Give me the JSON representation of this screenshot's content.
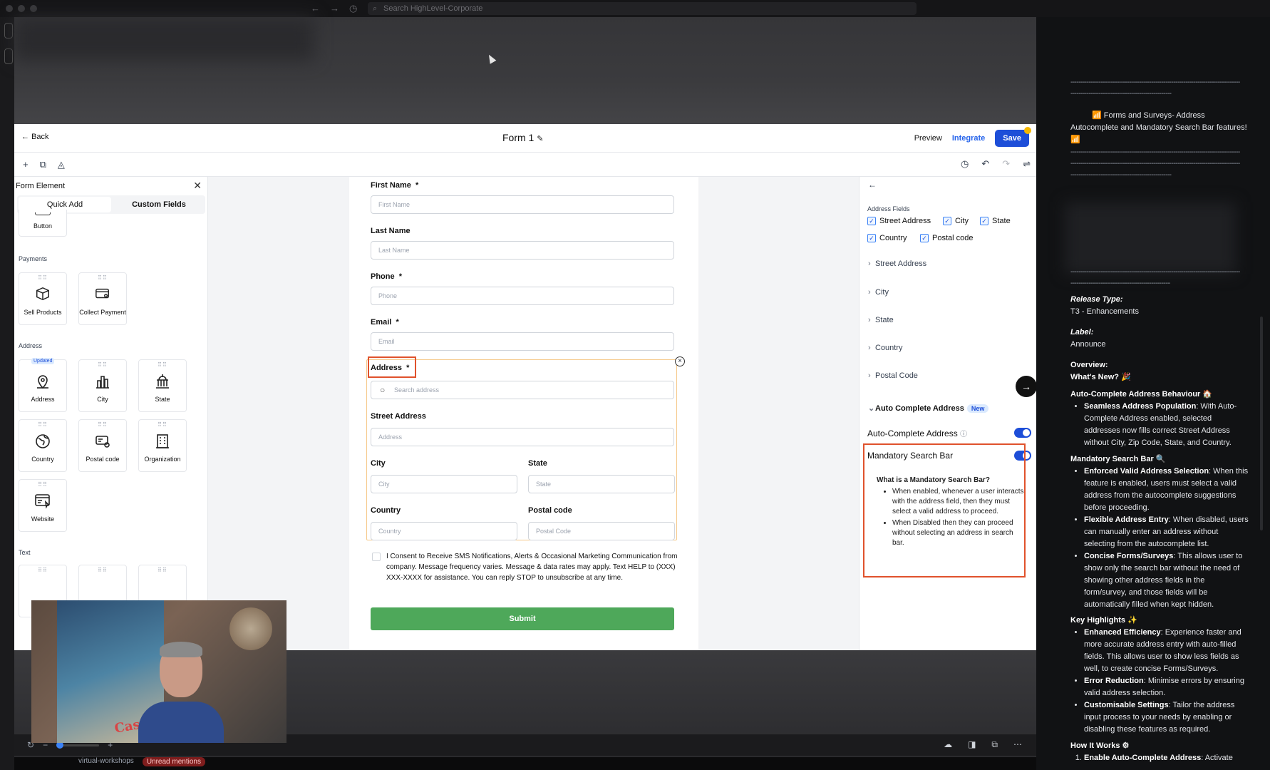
{
  "browser": {
    "search_placeholder": "Search HighLevel-Corporate"
  },
  "header": {
    "back_label": "Back",
    "form_title": "Form 1",
    "preview": "Preview",
    "integrate": "Integrate",
    "save": "Save"
  },
  "left_panel": {
    "title": "Form Element",
    "tabs": [
      "Quick Add",
      "Custom Fields"
    ],
    "button_tile": "Button",
    "payments_section": "Payments",
    "payments": [
      "Sell Products",
      "Collect Payment"
    ],
    "address_section": "Address",
    "updated_badge": "Updated",
    "address_tiles": [
      "Address",
      "City",
      "State",
      "Country",
      "Postal code",
      "Organization",
      "Website"
    ],
    "text_section": "Text"
  },
  "form": {
    "first_name_label": "First Name",
    "first_name_placeholder": "First Name",
    "last_name_label": "Last Name",
    "last_name_placeholder": "Last Name",
    "phone_label": "Phone",
    "phone_placeholder": "Phone",
    "email_label": "Email",
    "email_placeholder": "Email",
    "address_label": "Address",
    "required_mark": "*",
    "search_placeholder": "Search address",
    "street_label": "Street Address",
    "street_placeholder": "Address",
    "city_label": "City",
    "city_placeholder": "City",
    "state_label": "State",
    "state_placeholder": "State",
    "country_label": "Country",
    "country_placeholder": "Country",
    "postal_label": "Postal code",
    "postal_placeholder": "Postal Code",
    "consent": "I Consent to Receive SMS Notifications, Alerts & Occasional Marketing Communication from company. Message frequency varies. Message & data rates may apply. Text HELP to (XXX) XXX-XXXX for assistance. You can reply STOP to unsubscribe at any time.",
    "submit": "Submit"
  },
  "settings": {
    "section": "Address Fields",
    "checkboxes": [
      "Street Address",
      "City",
      "State",
      "Country",
      "Postal code"
    ],
    "accordions": [
      "Street Address",
      "City",
      "State",
      "Country",
      "Postal Code"
    ],
    "auto_complete_section": "Auto Complete Address",
    "new_badge": "New",
    "auto_complete_toggle": "Auto-Complete Address",
    "mandatory_toggle": "Mandatory Search Bar",
    "explain_title": "What is a Mandatory Search Bar?",
    "explain_items": [
      "When enabled, whenever a user interacts with the address field, then they must select a valid address to proceed.",
      "When Disabled then they can proceed without selecting an address in search bar."
    ]
  },
  "notes": {
    "dashes": "------------------------------------------------------------------------------------",
    "dashes_short": "--------------------------------------------------",
    "headline": "Forms and Surveys- Address Autocomplete and Mandatory Search Bar features!",
    "release_type_label": "Release Type:",
    "release_type": "T3 - Enhancements",
    "label_label": "Label:",
    "label_value": "Announce",
    "overview": "Overview:",
    "whats_new": "What's New?",
    "auto_heading": "Auto-Complete Address Behaviour",
    "auto_items": [
      {
        "b": "Seamless Address Population",
        "t": ": With Auto-Complete Address enabled, selected addresses now fills correct Street Address without City, Zip Code, State, and Country."
      }
    ],
    "mand_heading": "Mandatory Search Bar",
    "mand_items": [
      {
        "b": "Enforced Valid Address Selection",
        "t": ": When this feature is enabled, users must select a valid address from the autocomplete suggestions before proceeding."
      },
      {
        "b": "Flexible Address Entry",
        "t": ": When disabled, users can manually enter an address without selecting from the autocomplete list."
      },
      {
        "b": "Concise Forms/Surveys",
        "t": ": This allows user to show only the search bar without the need of showing other address fields in the form/survey, and those fields will be automatically filled when kept hidden."
      }
    ],
    "key_heading": "Key Highlights",
    "key_items": [
      {
        "b": "Enhanced Efficiency",
        "t": ": Experience faster and more accurate address entry with auto-filled fields. This allows user to show less fields as well, to create concise Forms/Surveys."
      },
      {
        "b": "Error Reduction",
        "t": ": Minimise errors by ensuring valid address selection."
      },
      {
        "b": "Customisable Settings",
        "t": ": Tailor the address input process to your needs by enabling or disabling these features as required."
      }
    ],
    "how_heading": "How It Works",
    "how_first": "Enable Auto-Complete Address",
    "how_first_rest": ": Activate"
  },
  "taskbar": {
    "channel": "virtual-workshops",
    "pill": "Unread mentions"
  },
  "webcam": {
    "poster_text": "Casablanca"
  },
  "colors": {
    "accent": "#1d4ed8",
    "submit": "#4ea85a",
    "highlight": "#e0522c"
  }
}
